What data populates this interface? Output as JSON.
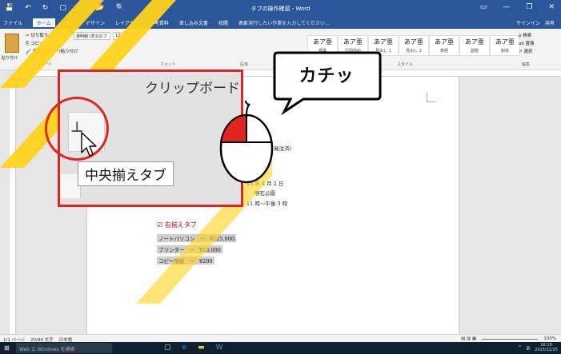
{
  "titlebar": {
    "title": "タブの操作確認 - Word",
    "qat": [
      "💾",
      "↶",
      "↻",
      "▢",
      "▭",
      "📂",
      "🔍"
    ],
    "window_buttons": [
      "▭",
      "—",
      "❐",
      "✕"
    ]
  },
  "tabs": [
    "ファイル",
    "ホーム",
    "挿入",
    "デザイン",
    "レイアウト",
    "参考資料",
    "差し込み文書",
    "校閲",
    "表示"
  ],
  "tell_me": "♀ 実行したい作業を入力してください...",
  "account": [
    "サインイン",
    "共有"
  ],
  "ribbon": {
    "paste_label": "貼り付け",
    "clipboard_items": [
      "✂ 切り取り",
      "⎘ コピー",
      "🖌 書式のコピー/貼り付け"
    ],
    "clipboard_group": "クリップボード",
    "font_name": "游明朝 (本文のフ",
    "font_size": "12",
    "font_group": "フォント",
    "paragraph_group": "段落",
    "styles": [
      {
        "sample": "あア亜",
        "name": "標準"
      },
      {
        "sample": "あア亜",
        "name": "行間詰め"
      },
      {
        "sample": "あア亜",
        "name": "見出し 1"
      },
      {
        "sample": "あア亜",
        "name": "見出し 2"
      },
      {
        "sample": "あア亜",
        "name": "表題"
      },
      {
        "sample": "あア亜",
        "name": "副題"
      },
      {
        "sample": "あア亜",
        "name": "斜体"
      }
    ],
    "styles_group": "スタイル",
    "edit_items": [
      "ρ 検索",
      "ab 置換",
      "↗ 選択"
    ],
    "edit_group": "編集"
  },
  "document": {
    "partial_line_1": "発注済)",
    "partial_line_2": "25 年 4 月 2 日",
    "partial_line_3": "明石公園",
    "partial_line_4": "11 時～午後 3 時",
    "section_heading": "☑ 右揃えタブ",
    "items": [
      "ノートパソコン　→　¥125,000",
      "プリンター　→　¥23,000",
      "コピー用紙　→　¥200"
    ]
  },
  "overlay": {
    "zoom_label": "クリップボード",
    "tooltip": "中央揃えタブ",
    "callout": "カチッ",
    "tab_glyph": "⊥"
  },
  "statusbar": {
    "page": "1/1 ページ",
    "words": "20/94 文字",
    "lang": "日本語",
    "zoom": "100%"
  },
  "taskbar": {
    "search": "Web と Windows を検索",
    "time": "16:19",
    "date": "2015/12/25",
    "ime": "あ"
  },
  "colors": {
    "word_blue": "#2b579a",
    "highlight_red": "#e0241f",
    "stripe_yellow": "#ffd21a"
  }
}
